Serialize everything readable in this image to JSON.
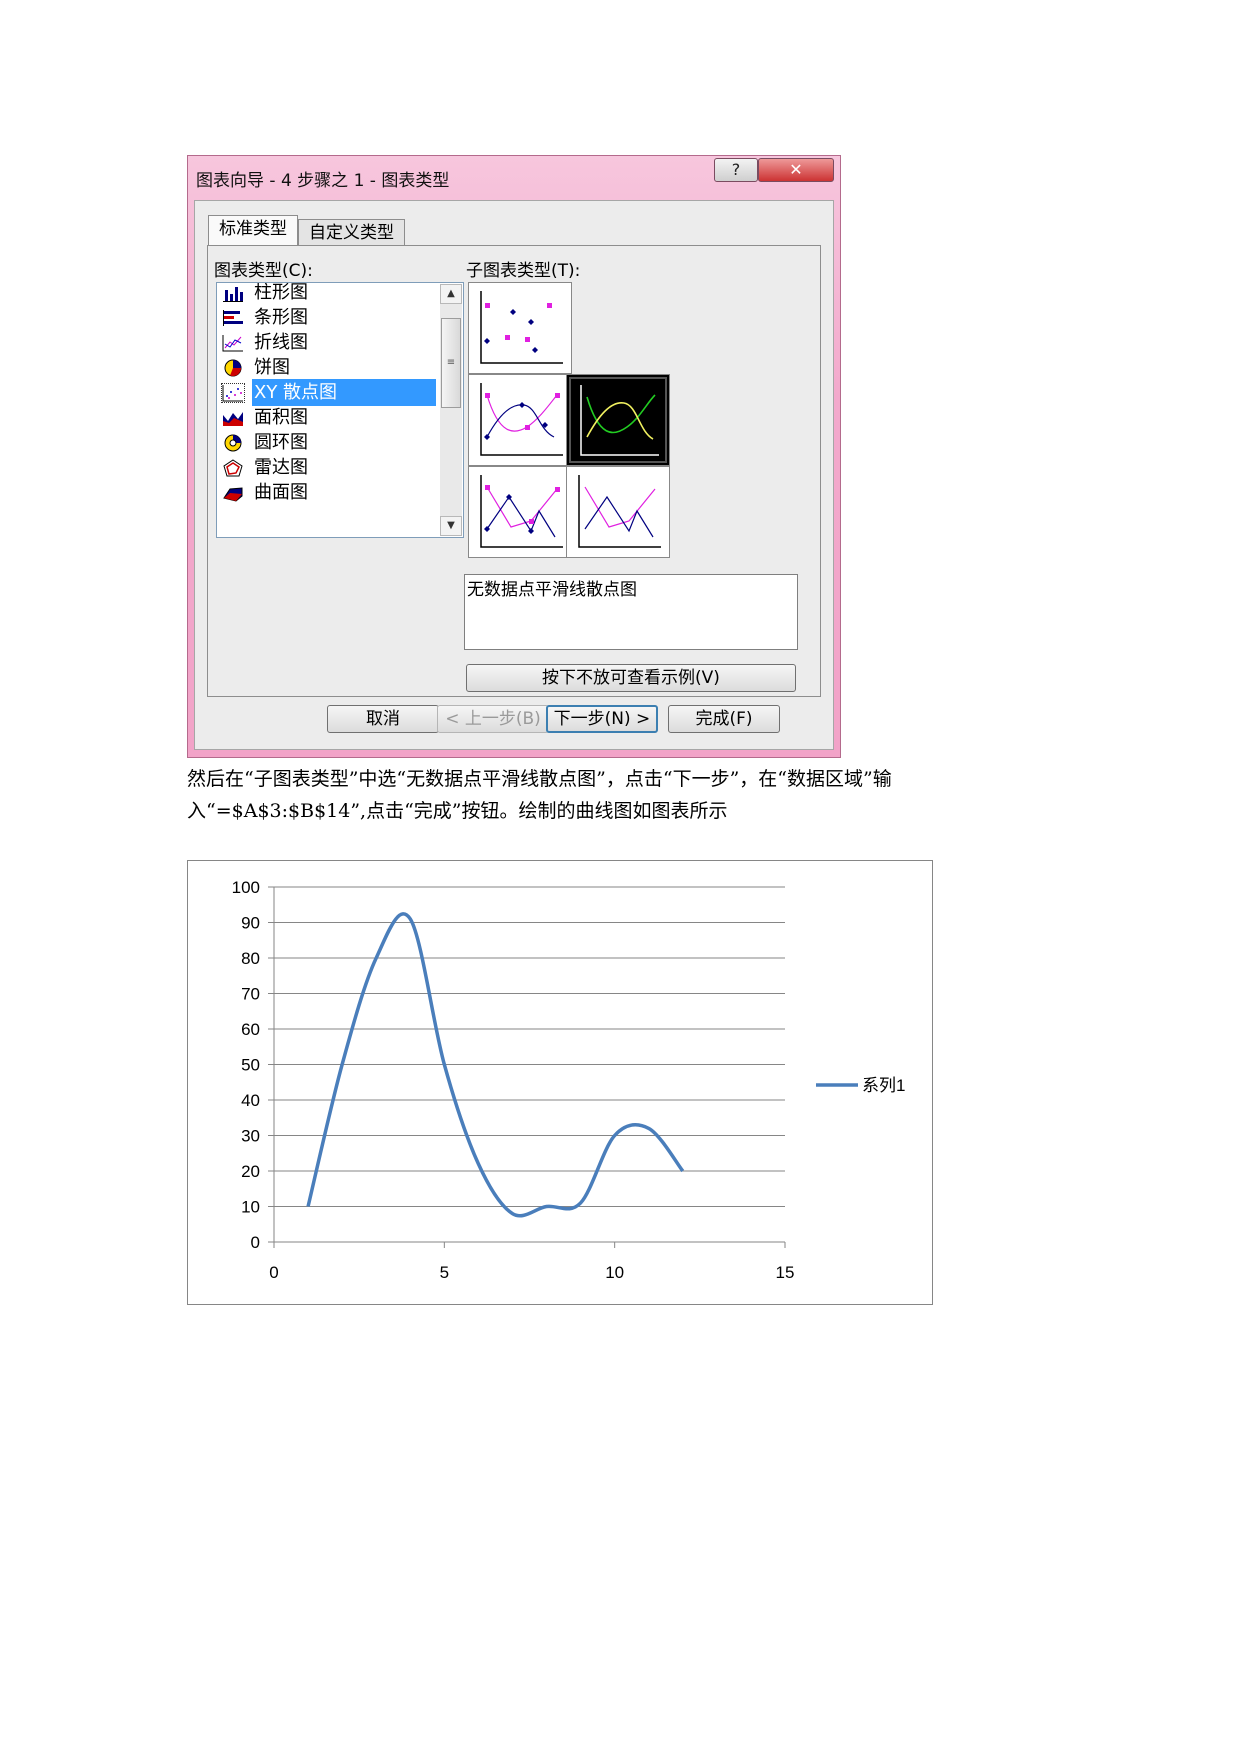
{
  "dialog": {
    "title": "图表向导 - 4 步骤之 1 - 图表类型",
    "help_glyph": "?",
    "close_glyph": "✕",
    "tabs": [
      {
        "label": "标准类型"
      },
      {
        "label": "自定义类型"
      }
    ],
    "chart_type_label": "图表类型(C):",
    "chart_types": [
      {
        "label": "柱形图",
        "icon": "column-chart-icon"
      },
      {
        "label": "条形图",
        "icon": "bar-chart-icon"
      },
      {
        "label": "折线图",
        "icon": "line-chart-icon"
      },
      {
        "label": "饼图",
        "icon": "pie-chart-icon"
      },
      {
        "label": "XY 散点图",
        "icon": "scatter-chart-icon",
        "selected": true
      },
      {
        "label": "面积图",
        "icon": "area-chart-icon"
      },
      {
        "label": "圆环图",
        "icon": "doughnut-chart-icon"
      },
      {
        "label": "雷达图",
        "icon": "radar-chart-icon"
      },
      {
        "label": "曲面图",
        "icon": "surface-chart-icon"
      }
    ],
    "subtype_label": "子图表类型(T):",
    "description": "无数据点平滑线散点图",
    "preview_button": "按下不放可查看示例(V)",
    "cancel_button": "取消",
    "back_button": "< 上一步(B)",
    "next_button": "下一步(N) >",
    "finish_button": "完成(F)"
  },
  "paragraph": {
    "line1": "然后在“子图表类型”中选“无数据点平滑线散点图”，点击“下一步”，在“数据区域”输",
    "line2": "入“=$A$3:$B$14”,点击“完成”按钮。绘制的曲线图如图表所示"
  },
  "chart_data": {
    "type": "scatter",
    "smooth": true,
    "series": [
      {
        "name": "系列1",
        "color": "#4a7ebb",
        "x": [
          1,
          2,
          3,
          4,
          5,
          6,
          7,
          8,
          9,
          10,
          11,
          12
        ],
        "y": [
          10,
          50,
          80,
          91,
          50,
          22,
          8,
          10,
          11,
          30,
          32,
          20
        ]
      }
    ],
    "xlim": [
      0,
      15
    ],
    "ylim": [
      0,
      100
    ],
    "xticks": [
      0,
      5,
      10,
      15
    ],
    "yticks": [
      0,
      10,
      20,
      30,
      40,
      50,
      60,
      70,
      80,
      90,
      100
    ],
    "grid": "horizontal",
    "legend": "right"
  }
}
